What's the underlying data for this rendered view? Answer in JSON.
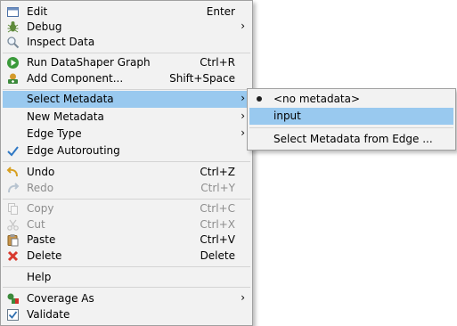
{
  "context_menu": {
    "items": [
      {
        "label": "Edit",
        "accel": "Enter",
        "icon": "edit-icon"
      },
      {
        "label": "Debug",
        "icon": "debug-icon",
        "submenu": true
      },
      {
        "label": "Inspect Data",
        "icon": "magnifier-icon"
      },
      {
        "label": "Run DataShaper Graph",
        "accel": "Ctrl+R",
        "icon": "run-icon"
      },
      {
        "label": "Add Component...",
        "accel": "Shift+Space",
        "icon": "add-component-icon"
      },
      {
        "label": "Select Metadata",
        "submenu": true,
        "highlighted": true
      },
      {
        "label": "New Metadata",
        "submenu": true
      },
      {
        "label": "Edge Type",
        "submenu": true
      },
      {
        "label": "Edge Autorouting",
        "icon": "checkmark-icon",
        "checked": true
      },
      {
        "label": "Undo",
        "accel": "Ctrl+Z",
        "icon": "undo-icon"
      },
      {
        "label": "Redo",
        "accel": "Ctrl+Y",
        "icon": "redo-icon",
        "disabled": true
      },
      {
        "label": "Copy",
        "accel": "Ctrl+C",
        "icon": "copy-icon",
        "disabled": true
      },
      {
        "label": "Cut",
        "accel": "Ctrl+X",
        "icon": "cut-icon",
        "disabled": true
      },
      {
        "label": "Paste",
        "accel": "Ctrl+V",
        "icon": "paste-icon"
      },
      {
        "label": "Delete",
        "accel": "Delete",
        "icon": "delete-icon"
      },
      {
        "label": "Help"
      },
      {
        "label": "Coverage As",
        "icon": "coverage-icon",
        "submenu": true
      },
      {
        "label": "Validate",
        "icon": "validate-checkbox-icon"
      }
    ],
    "arrow": "›"
  },
  "metadata_submenu": {
    "items": [
      {
        "label": "<no metadata>",
        "selected": true
      },
      {
        "label": "input",
        "highlighted": true
      },
      {
        "label": "Select Metadata from Edge ..."
      }
    ]
  },
  "colors": {
    "menu_bg": "#f2f2f2",
    "highlight": "#99c9ef",
    "disabled_text": "#8d8d8d",
    "separator": "#d4d4d4"
  }
}
